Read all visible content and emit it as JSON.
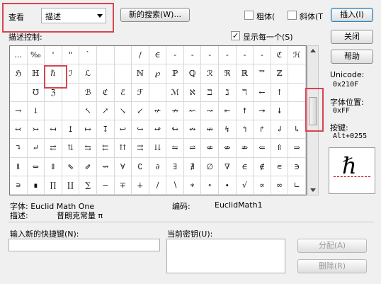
{
  "toolbar": {
    "view_label": "查看",
    "view_select": "描述",
    "new_search": "新的搜索(W)...",
    "bold_label": "粗体(",
    "italic_label": "斜体(T",
    "insert_button": "插入(I)"
  },
  "panel": {
    "grid_label": "描述控制:",
    "show_each_label": "显示每一个(S)"
  },
  "side": {
    "close_button": "关闭",
    "help_button": "帮助",
    "unicode_label": "Unicode:",
    "unicode_value": "0x210F",
    "font_pos_label": "字体位置:",
    "font_pos_value": "0xFF",
    "key_label": "按键:",
    "key_value": "Alt+0255",
    "preview_char": "ℏ"
  },
  "info": {
    "font_label": "字体: Euclid Math One",
    "encoding_label": "编码:",
    "encoding_value": "EuclidMath1",
    "desc_label": "描述:",
    "desc_value": "普朗克常量 π"
  },
  "shortcut": {
    "new_key_label": "输入新的快捷键(N):",
    "current_key_label": "当前密钥(U):",
    "assign_button": "分配(A)",
    "delete_button": "删除(R)"
  },
  "symbols": [
    [
      "…",
      "‰",
      "'",
      "\"",
      "`",
      "",
      "",
      "/",
      "∈",
      "-",
      "-",
      "-",
      "-",
      "-",
      "-",
      "ℭ",
      "ℋ"
    ],
    [
      "ℌ",
      "ℍ",
      "ℏ",
      "ℐ",
      "ℒ",
      "",
      "",
      "ℕ",
      "℘",
      "ℙ",
      "ℚ",
      "ℛ",
      "ℜ",
      "ℝ",
      "™",
      "ℤ",
      ""
    ],
    [
      "",
      "℧",
      "ℨ",
      "",
      "ℬ",
      "ℭ",
      "ℰ",
      "ℱ",
      "",
      "ℳ",
      "ℵ",
      "ℶ",
      "ℷ",
      "ℸ",
      "←",
      "↑",
      ""
    ],
    [
      "→",
      "↓",
      "",
      "",
      "↖",
      "↗",
      "↘",
      "↙",
      "↚",
      "↛",
      "↜",
      "↝",
      "↞",
      "↟",
      "↠",
      "↡",
      ""
    ],
    [
      "↢",
      "↣",
      "↤",
      "↥",
      "↦",
      "↧",
      "↩",
      "↪",
      "↫",
      "↬",
      "↭",
      "↮",
      "↯",
      "↰",
      "↱",
      "↲",
      "↳"
    ],
    [
      "↴",
      "↵",
      "⇄",
      "⇅",
      "⇆",
      "⇇",
      "⇈",
      "⇉",
      "⇊",
      "⇋",
      "⇌",
      "⇍",
      "⇎",
      "⇏",
      "⇐",
      "⇑",
      "⇒"
    ],
    [
      "⇓",
      "⇔",
      "⇕",
      "⇖",
      "⇗",
      "⇝",
      "∀",
      "∁",
      "∂",
      "∃",
      "∄",
      "∅",
      "∇",
      "∈",
      "∉",
      "∊",
      "∋"
    ],
    [
      "∍",
      "∎",
      "∏",
      "∐",
      "∑",
      "−",
      "∓",
      "∔",
      "∕",
      "∖",
      "∗",
      "∘",
      "∙",
      "√",
      "∝",
      "∞",
      "∟"
    ]
  ]
}
